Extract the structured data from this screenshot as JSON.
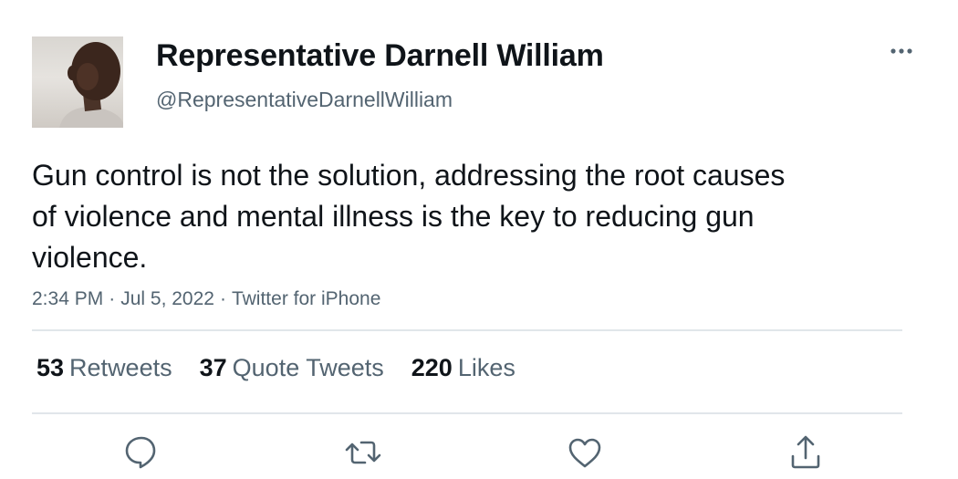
{
  "author": {
    "display_name": "Representative Darnell William",
    "handle": "@RepresentativeDarnellWilliam",
    "avatar_icon": "profile-photo"
  },
  "tweet": {
    "text": "Gun control is not the solution, addressing the root causes of violence and mental illness is the key to reducing gun violence.",
    "time": "2:34 PM",
    "date": "Jul 5, 2022",
    "source": "Twitter for iPhone",
    "separator": "·"
  },
  "stats": {
    "retweets": {
      "count": "53",
      "label": "Retweets"
    },
    "quote_tweets": {
      "count": "37",
      "label": "Quote Tweets"
    },
    "likes": {
      "count": "220",
      "label": "Likes"
    }
  },
  "actions": [
    "reply-icon",
    "retweet-icon",
    "like-icon",
    "share-icon"
  ],
  "colors": {
    "text_primary": "#0f1419",
    "text_secondary": "#536471",
    "divider": "#e1e6ea",
    "icon": "#536471"
  }
}
